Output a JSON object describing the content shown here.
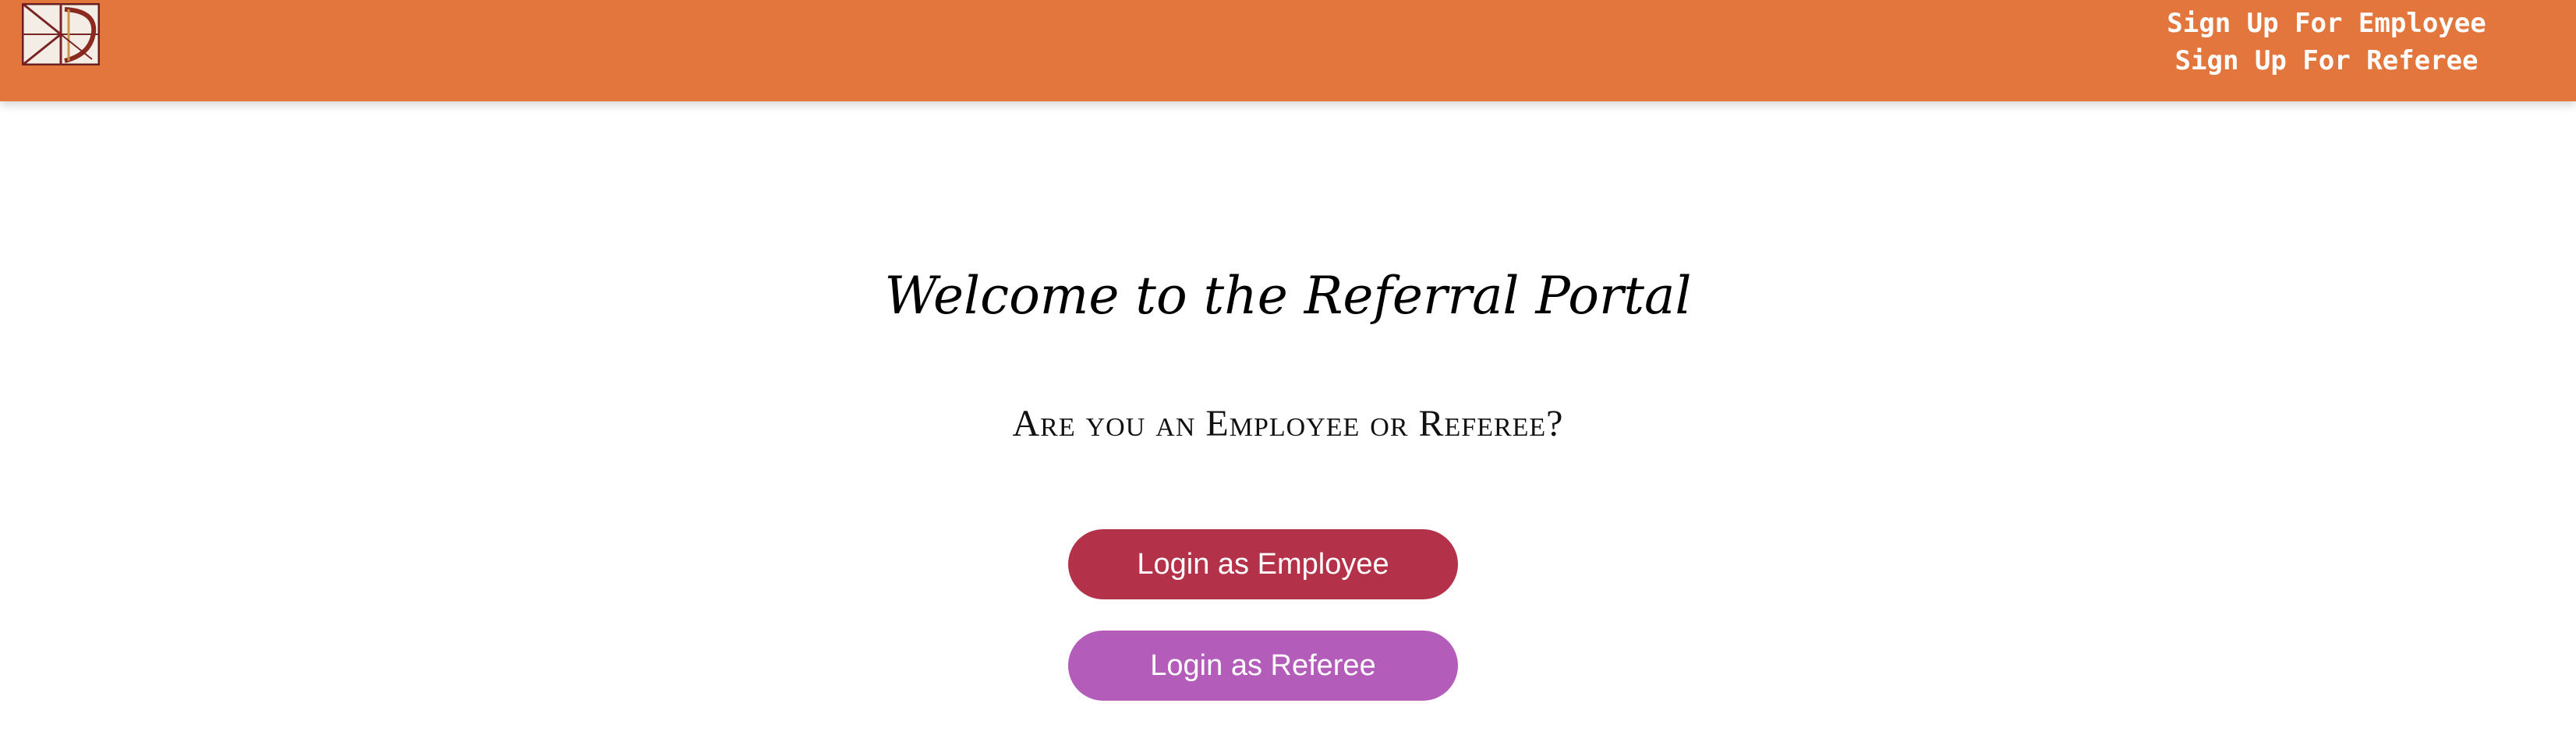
{
  "header": {
    "logo_icon": "hd-monogram-logo-icon",
    "nav_links": [
      {
        "label": "Sign Up For Employee"
      },
      {
        "label": "Sign Up For Referee"
      }
    ],
    "background_color": "#e3763c"
  },
  "main": {
    "title": "Welcome to the Referral Portal",
    "question": "Are you an Employee or Referee?",
    "buttons": {
      "employee_login": "Login as Employee",
      "referee_login": "Login as Referee"
    },
    "colors": {
      "employee_button": "#b3324a",
      "referee_button": "#b45cba"
    }
  }
}
